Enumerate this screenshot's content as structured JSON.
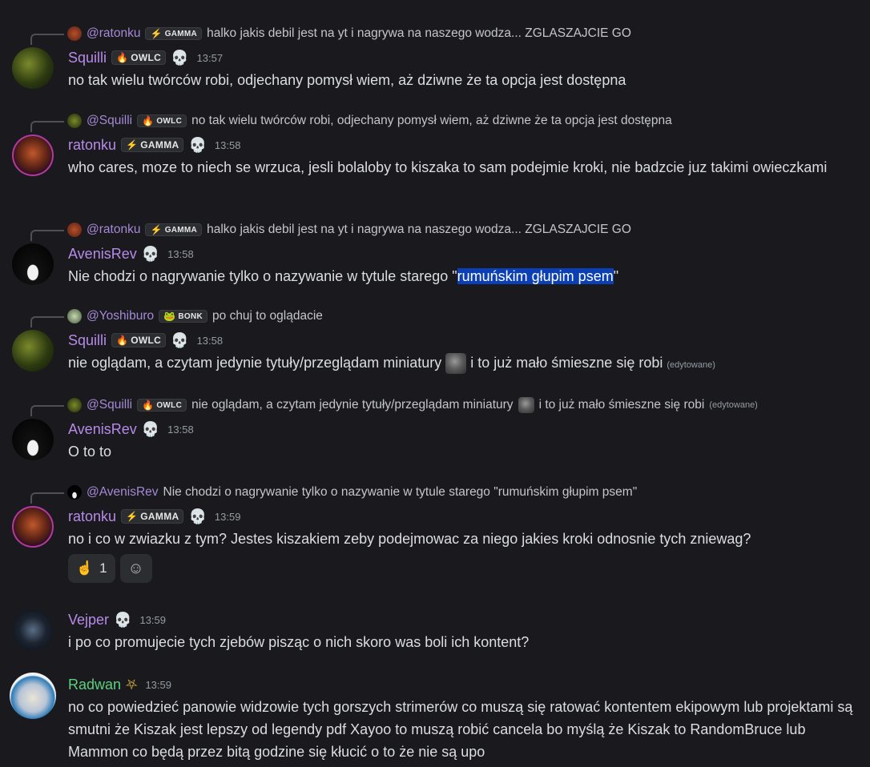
{
  "messages": [
    {
      "reply": {
        "name": "@ratonku",
        "tag": "GAMMA",
        "text": "halko jakis debil jest na yt i nagrywa na naszego wodza... ZGLASZAJCIE GO"
      },
      "author": "Squilli",
      "tag": "OWLC",
      "time": "13:57",
      "text": "no tak wielu twórców robi, odjechany pomysł wiem, aż dziwne że ta opcja jest dostępna"
    },
    {
      "reply": {
        "name": "@Squilli",
        "tag": "OWLC",
        "text": "no tak wielu twórców robi, odjechany pomysł wiem, aż dziwne że ta opcja jest dostępna"
      },
      "author": "ratonku",
      "tag": "GAMMA",
      "time": "13:58",
      "text": "who cares, moze to niech se wrzuca, jesli bolaloby to kiszaka to sam podejmie kroki, nie badzcie juz takimi owieczkami"
    },
    {
      "reply": {
        "name": "@ratonku",
        "tag": "GAMMA",
        "text": "halko jakis debil jest na yt i nagrywa na naszego wodza... ZGLASZAJCIE GO"
      },
      "author": "AvenisRev",
      "time": "13:58",
      "text_before": "Nie chodzi o nagrywanie tylko o nazywanie w tytule starego \"",
      "text_highlight": "rumuńskim głupim psem",
      "text_after": "\""
    },
    {
      "reply": {
        "name": "@Yoshiburo",
        "tag": "BONK",
        "text": "po chuj to oglądacie"
      },
      "author": "Squilli",
      "tag": "OWLC",
      "time": "13:58",
      "text_before": "nie oglądam, a czytam jedynie tytuły/przeglądam miniatury",
      "text_after": "i to już mało śmieszne się robi",
      "edited": "(edytowane)"
    },
    {
      "reply": {
        "name": "@Squilli",
        "tag": "OWLC",
        "text_before": "nie oglądam, a czytam jedynie tytuły/przeglądam miniatury",
        "text_after": "i to już mało śmieszne się robi",
        "edited": "(edytowane)"
      },
      "author": "AvenisRev",
      "time": "13:58",
      "text": "O to to"
    },
    {
      "reply": {
        "name": "@AvenisRev",
        "text": "Nie chodzi o nagrywanie tylko o nazywanie w tytule starego \"rumuńskim głupim psem\""
      },
      "author": "ratonku",
      "tag": "GAMMA",
      "time": "13:59",
      "text": "no i co w zwiazku z tym? Jestes kiszakiem zeby podejmowac za niego jakies kroki odnosnie tych zniewag?",
      "reaction": {
        "emoji": "☝",
        "count": "1"
      }
    },
    {
      "author": "Vejper",
      "time": "13:59",
      "text": "i po co promujecie tych zjebów pisząc o nich skoro was boli ich kontent?"
    },
    {
      "author": "Radwan",
      "time": "13:59",
      "text": "no co powiedzieć panowie widzowie tych gorszych strimerów co muszą się ratować kontentem ekipowym lub projektami są smutni że Kiszak jest lepszy od legendy pdf Xayoo to muszą robić cancela bo myślą że Kiszak to RandomBruce lub Mammon co będą przez bitą godzine się kłucić o to że nie są upo"
    }
  ],
  "icons": {
    "skull": "skull-icon",
    "pentagram": "pentagram-icon",
    "add_reaction": "smiley-icon"
  },
  "colors": {
    "username_purple": "#b68be8",
    "username_green": "#5bd07c",
    "highlight": "#0a3fb6",
    "background": "#1a1a1e"
  }
}
